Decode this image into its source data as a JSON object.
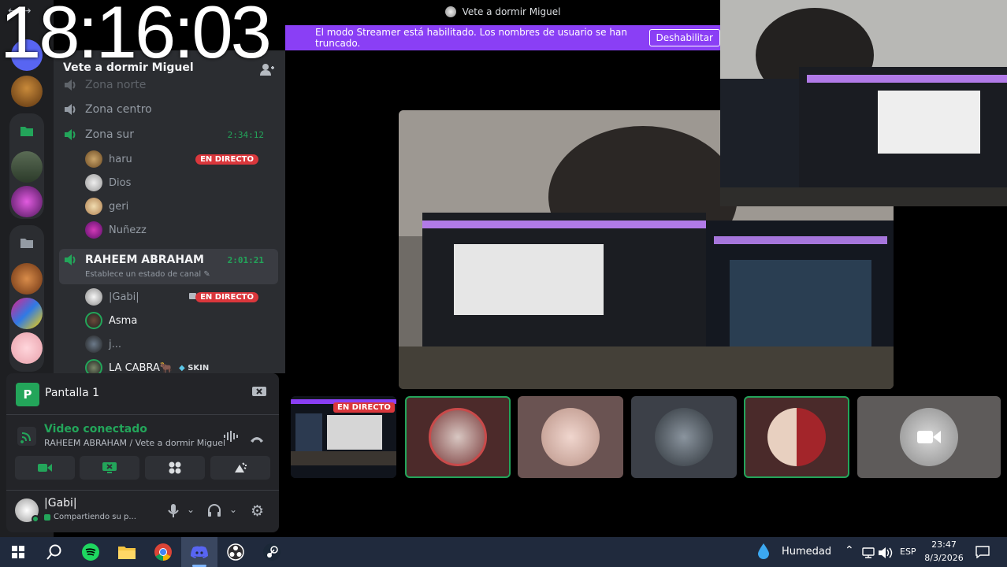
{
  "window": {
    "title": "Vete a dormir Miguel"
  },
  "clock_overlay": "18:16:03",
  "banner": {
    "message": "El modo Streamer está habilitado. Los nombres de usuario se han truncado.",
    "button": "Deshabilitar"
  },
  "server": {
    "name": "Vete a dormir Miguel"
  },
  "channels": {
    "top_partial": "Zona norte",
    "zona_centro": "Zona centro",
    "zona_sur": {
      "name": "Zona sur",
      "time": "2:34:12"
    },
    "zona_sur_users": [
      {
        "name": "haru",
        "live": "EN DIRECTO"
      },
      {
        "name": "Dios"
      },
      {
        "name": "geri"
      },
      {
        "name": "Nuñezz"
      }
    ],
    "active": {
      "name": "RAHEEM ABRAHAM",
      "time": "2:01:21",
      "status": "Establece un estado de canal"
    },
    "active_users": [
      {
        "name": "|Gabi|",
        "live": "EN DIRECTO"
      },
      {
        "name": "Asma"
      },
      {
        "name": "j..."
      },
      {
        "name": "LA CABRA🐂",
        "tag": "SKIN"
      }
    ]
  },
  "voice_panel": {
    "stream_title": "Pantalla 1",
    "status": "Video conectado",
    "location": "RAHEEM ABRAHAM / Vete a dormir Miguel",
    "user_name": "|Gabi|",
    "user_status": "Compartiendo su p..."
  },
  "tiles": {
    "live_badge": "EN DIRECTO"
  },
  "taskbar": {
    "weather": "Humedad",
    "language": "ESP",
    "time": "23:47",
    "date": "8/3/2026"
  },
  "colors": {
    "accent_purple": "#8a3ff5",
    "green": "#23a55a",
    "live_red": "#da373c"
  }
}
